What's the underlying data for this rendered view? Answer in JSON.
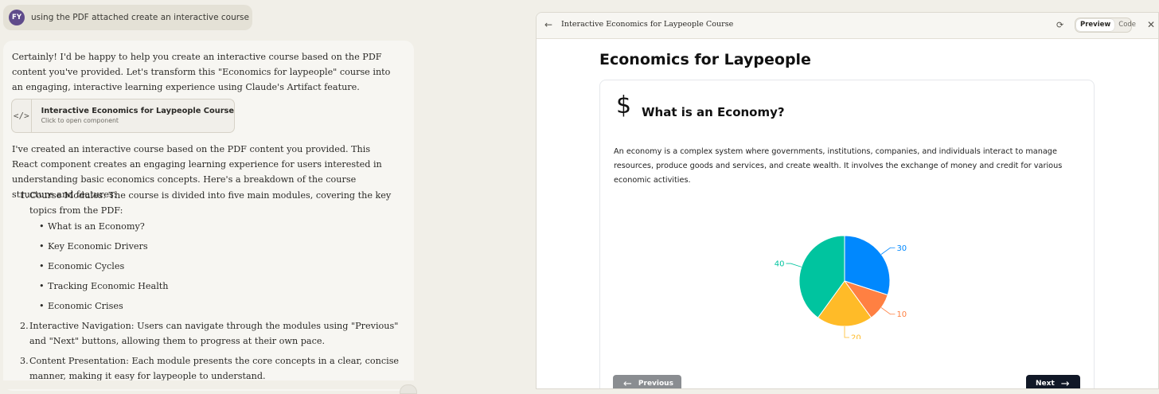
{
  "user_message": {
    "avatar_initials": "FY",
    "text": "using the PDF attached create an interactive course"
  },
  "assistant": {
    "intro": "Certainly! I'd be happy to help you create an interactive course based on the PDF content you've provided. Let's transform this \"Economics for laypeople\" course into an engaging, interactive learning experience using Claude's Artifact feature.",
    "artifact_card": {
      "icon": "</>",
      "title": "Interactive Economics for Laypeople Course",
      "subtitle": "Click to open component"
    },
    "summary": "I've created an interactive course based on the PDF content you provided. This React component creates an engaging learning experience for users interested in understanding basic economics concepts. Here's a breakdown of the course structure and features:",
    "list": [
      {
        "text": "Course Modules: The course is divided into five main modules, covering the key topics from the PDF:",
        "sub": [
          "What is an Economy?",
          "Key Economic Drivers",
          "Economic Cycles",
          "Tracking Economic Health",
          "Economic Crises"
        ]
      },
      {
        "text": "Interactive Navigation: Users can navigate through the modules using \"Previous\" and \"Next\" buttons, allowing them to progress at their own pace."
      },
      {
        "text": "Content Presentation: Each module presents the core concepts in a clear, concise manner, making it easy for laypeople to understand."
      }
    ]
  },
  "artifact_panel": {
    "title": "Interactive Economics for Laypeople Course",
    "tabs": {
      "preview": "Preview",
      "code": "Code"
    },
    "active_tab": "preview",
    "course_title": "Economics for Laypeople",
    "module": {
      "icon": "$",
      "title": "What is an Economy?",
      "text": "An economy is a complex system where governments, institutions, companies, and individuals interact to manage resources, produce goods and services, and create wealth. It involves the exchange of money and credit for various economic activities."
    },
    "buttons": {
      "previous": "Previous",
      "next": "Next"
    }
  },
  "chart_data": {
    "type": "pie",
    "values": [
      30,
      10,
      20,
      40
    ],
    "colors": [
      "#0088FE",
      "#FF8042",
      "#FFBB28",
      "#00C49F"
    ],
    "labels": [
      "30",
      "10",
      "20",
      "40"
    ]
  }
}
